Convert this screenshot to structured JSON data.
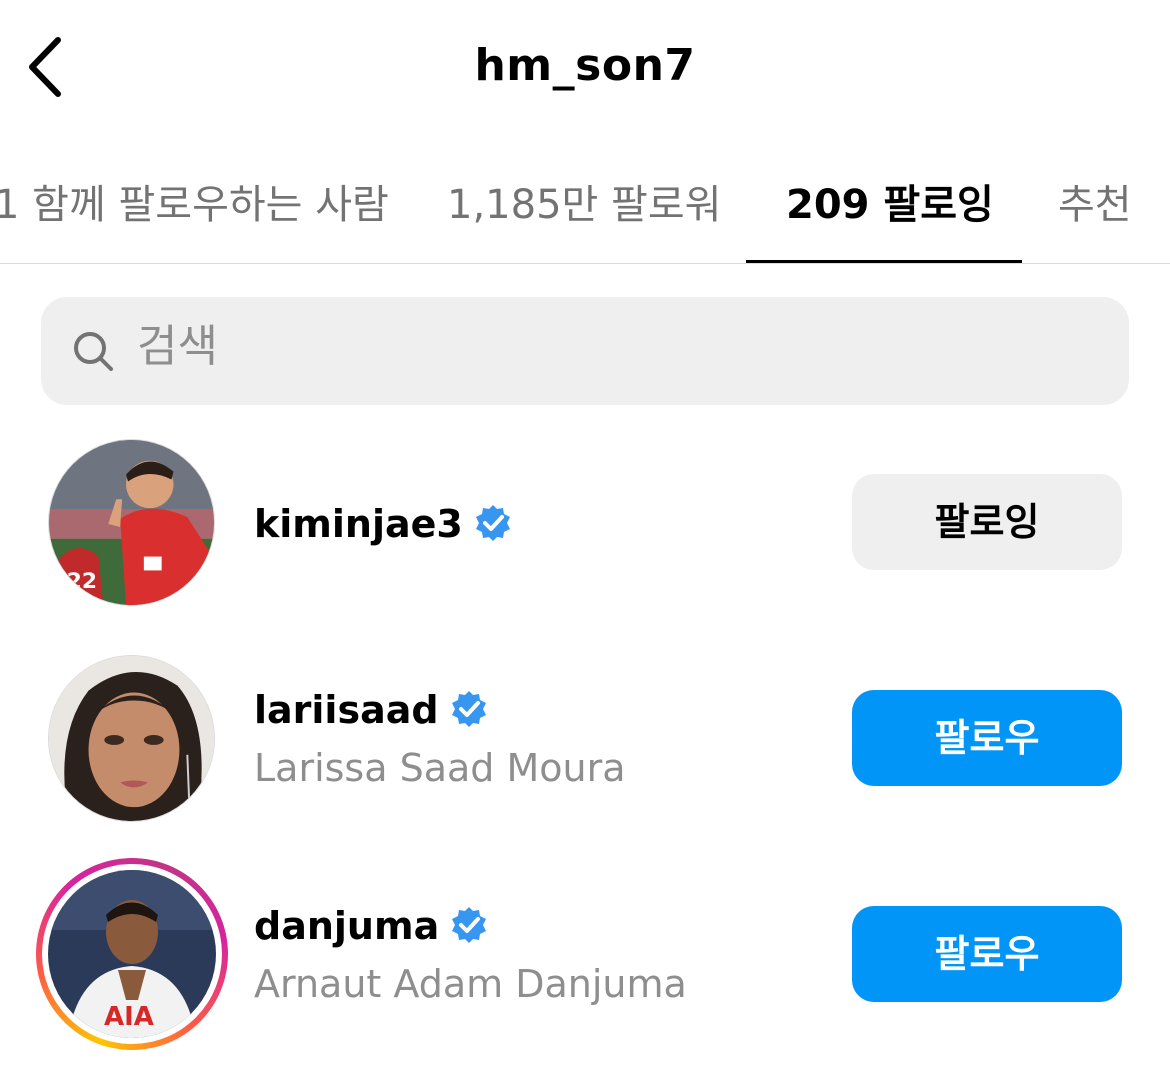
{
  "header": {
    "title": "hm_son7",
    "back_icon": "chevron-left-icon"
  },
  "tabs": [
    {
      "label": "1 함께 팔로우하는 사람",
      "active": false
    },
    {
      "label": "1,185만 팔로워",
      "active": false
    },
    {
      "label": "209 팔로잉",
      "active": true
    },
    {
      "label": "추천",
      "active": false
    }
  ],
  "search": {
    "placeholder": "검색",
    "icon": "search-icon"
  },
  "users": [
    {
      "username": "kiminjae3",
      "full_name": "",
      "verified": true,
      "button_label": "팔로잉",
      "button_style": "following",
      "has_story": false
    },
    {
      "username": "lariisaad",
      "full_name": "Larissa Saad Moura",
      "verified": true,
      "button_label": "팔로우",
      "button_style": "follow",
      "has_story": false
    },
    {
      "username": "danjuma",
      "full_name": "Arnaut Adam Danjuma",
      "verified": true,
      "button_label": "팔로우",
      "button_style": "follow",
      "has_story": true
    }
  ],
  "colors": {
    "follow_button": "#0095f6",
    "following_button": "#efefef",
    "verified_badge": "#3797f0",
    "secondary_text": "#8e8e8e"
  }
}
